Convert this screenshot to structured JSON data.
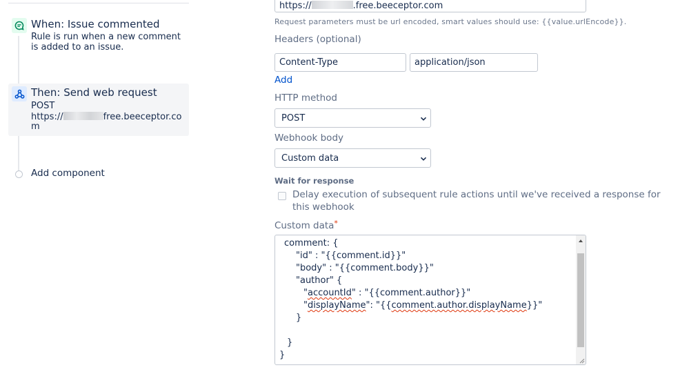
{
  "rule": {
    "trigger": {
      "icon": "comment-icon",
      "title": "When: Issue commented",
      "description": "Rule is run when a new comment is added to an issue."
    },
    "action": {
      "icon": "webhook-icon",
      "title": "Then: Send web request",
      "method": "POST",
      "url_prefix": "https://",
      "url_suffix": "free.beeceptor.com"
    },
    "add_component": "Add component"
  },
  "form": {
    "url": {
      "prefix": "https://",
      "suffix": ".free.beeceptor.com"
    },
    "url_helper": "Request parameters must be url encoded, smart values should use: {{value.urlEncode}}.",
    "headers_label": "Headers (optional)",
    "header_key": "Content-Type",
    "header_value": "application/json",
    "add_link": "Add",
    "http_method_label": "HTTP method",
    "http_method_value": "POST",
    "webhook_body_label": "Webhook body",
    "webhook_body_value": "Custom data",
    "wait_label": "Wait for response",
    "wait_checkbox_label": "Delay execution of subsequent rule actions until we've received a response for this webhook",
    "wait_checked": false,
    "custom_data_label": "Custom data",
    "required_mark": "*",
    "custom_data": {
      "l1": "comment: {",
      "l2": "\"id\" : \"{{comment.id}}\"",
      "l3": "\"body\" : \"{{comment.body}}\"",
      "l4": "\"author\" {",
      "l5_q": "\"",
      "l5_key": "accountId",
      "l5_rest": "\" : \"{{comment.author}}\"",
      "l6_q": "\"",
      "l6_key": "displayName",
      "l6_mid": "\": \"{{",
      "l6_val": "comment.author.displayName",
      "l6_end": "}}\"",
      "l7": "}",
      "l8": "}",
      "l9": "}"
    }
  },
  "colors": {
    "link": "#0052cc",
    "text": "#172b4d",
    "muted": "#5e6c84",
    "required": "#de350b",
    "trigger_icon_bg": "#e3fcef",
    "action_icon_bg": "#deebff"
  }
}
